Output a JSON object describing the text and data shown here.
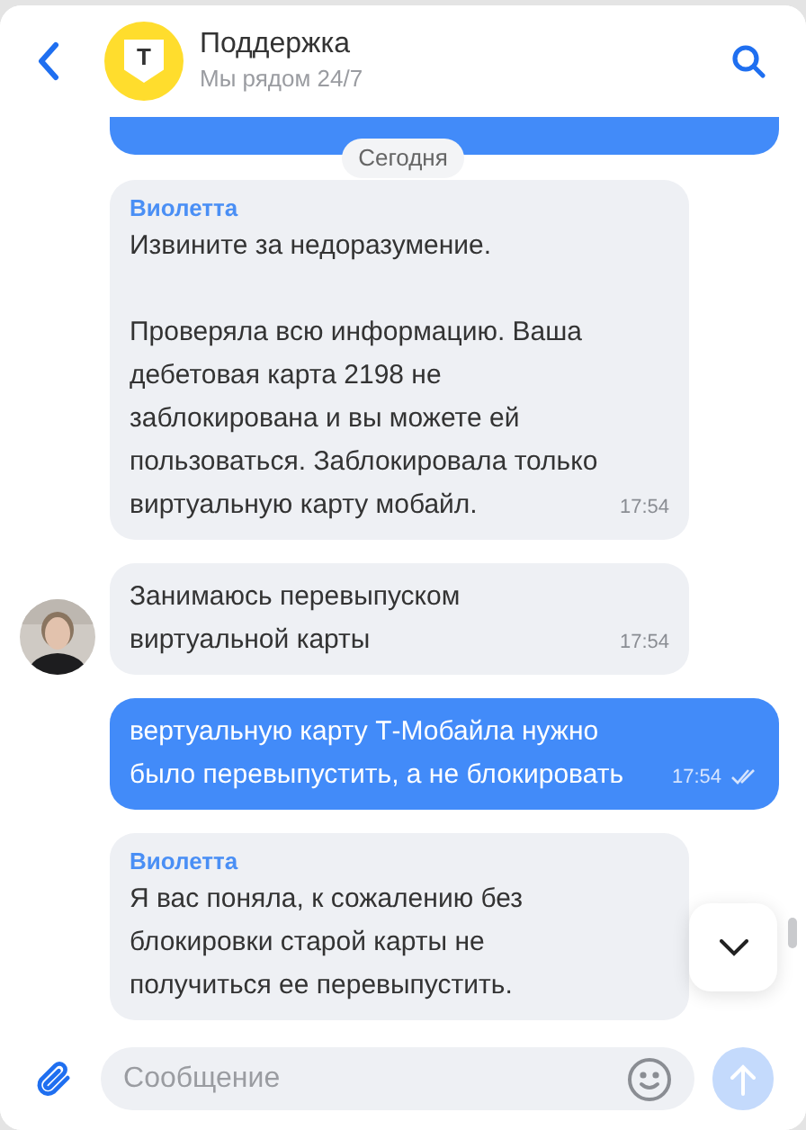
{
  "header": {
    "logo_letter": "Т",
    "title": "Поддержка",
    "subtitle": "Мы рядом 24/7"
  },
  "date_divider": "Сегодня",
  "messages": [
    {
      "kind": "incoming",
      "sender": "Виолетта",
      "avatar": false,
      "text": "Извините за недоразумение.\n\nПроверяла всю информацию. Ваша дебетовая карта 2198 не заблокирована и вы можете ей пользоваться. Заблокировала только виртуальную карту мобайл.",
      "time": "17:54"
    },
    {
      "kind": "incoming",
      "avatar": true,
      "text": "Занимаюсь перевыпуском виртуальной карты",
      "time": "17:54"
    },
    {
      "kind": "outgoing",
      "text": "вертуальную карту Т-Мобайла нужно было перевыпустить, а не блокировать",
      "time": "17:54",
      "read": true
    },
    {
      "kind": "incoming",
      "sender": "Виолетта",
      "avatar": false,
      "text": "Я вас поняла, к сожалению без блокировки старой карты не получиться ее перевыпустить."
    }
  ],
  "composer": {
    "placeholder": "Сообщение"
  }
}
